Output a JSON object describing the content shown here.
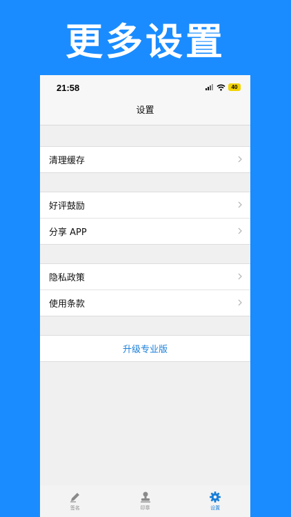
{
  "promo": {
    "title": "更多设置"
  },
  "status_bar": {
    "time": "21:58",
    "battery": "40"
  },
  "nav": {
    "title": "设置"
  },
  "groups": [
    {
      "items": [
        {
          "label": "清理缓存"
        }
      ]
    },
    {
      "items": [
        {
          "label": "好评鼓励"
        },
        {
          "label": "分享 APP"
        }
      ]
    },
    {
      "items": [
        {
          "label": "隐私政策"
        },
        {
          "label": "使用条款"
        }
      ]
    }
  ],
  "upgrade": {
    "label": "升级专业版"
  },
  "tabs": [
    {
      "label": "签名",
      "icon": "pen-icon",
      "active": false
    },
    {
      "label": "印章",
      "icon": "stamp-icon",
      "active": false
    },
    {
      "label": "设置",
      "icon": "gear-icon",
      "active": true
    }
  ],
  "colors": {
    "background": "#1a8cff",
    "accent": "#1a7fd9",
    "battery": "#f2d300"
  }
}
